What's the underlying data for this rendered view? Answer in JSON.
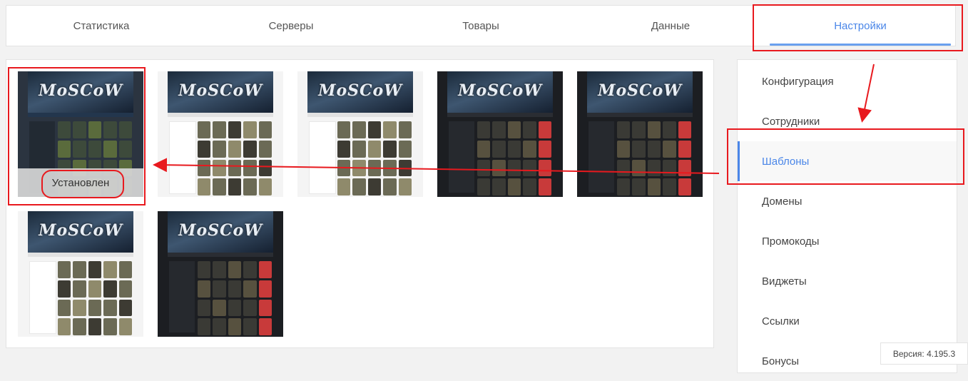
{
  "tabs": [
    {
      "label": "Статистика"
    },
    {
      "label": "Серверы"
    },
    {
      "label": "Товары"
    },
    {
      "label": "Данные"
    },
    {
      "label": "Настройки",
      "active": true
    }
  ],
  "templates": {
    "logo_text": "MoSCoW",
    "installed_label": "Установлен",
    "items": [
      {
        "theme": "navy",
        "installed": true
      },
      {
        "theme": "light"
      },
      {
        "theme": "light"
      },
      {
        "theme": "dark"
      },
      {
        "theme": "dark"
      },
      {
        "theme": "light"
      },
      {
        "theme": "dark"
      }
    ]
  },
  "sidebar": {
    "items": [
      {
        "label": "Конфигурация"
      },
      {
        "label": "Сотрудники"
      },
      {
        "label": "Шаблоны",
        "active": true
      },
      {
        "label": "Домены"
      },
      {
        "label": "Промокоды"
      },
      {
        "label": "Виджеты"
      },
      {
        "label": "Ссылки"
      },
      {
        "label": "Бонусы"
      }
    ]
  },
  "version": "Версия: 4.195.3",
  "colors": {
    "accent": "#4a86e8",
    "annotation_red": "#e8191e"
  }
}
